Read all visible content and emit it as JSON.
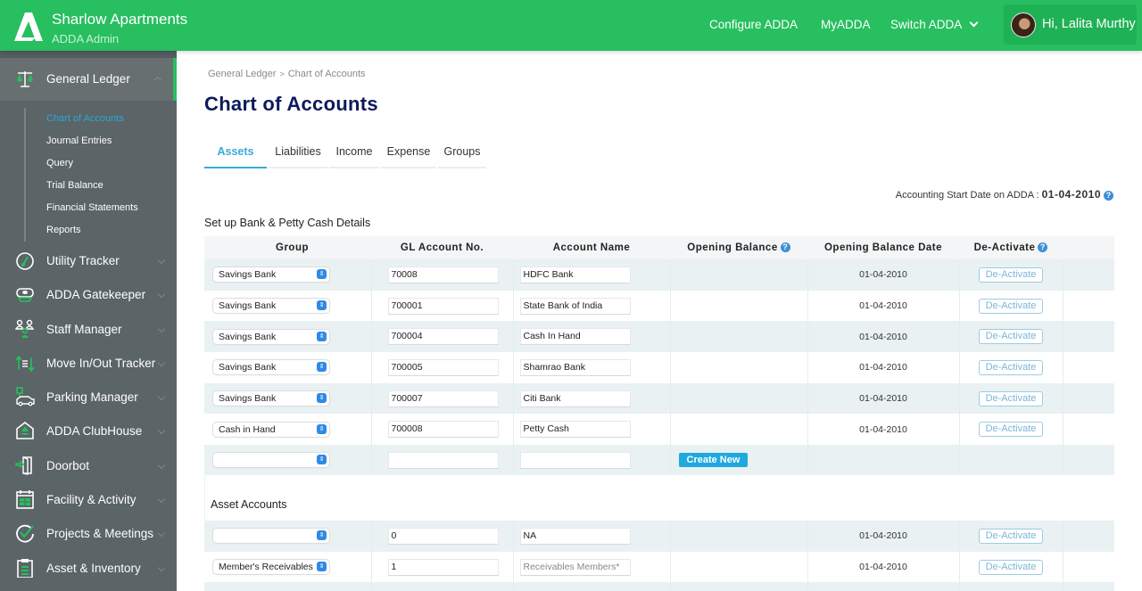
{
  "header": {
    "org_name": "Sharlow Apartments",
    "role": "ADDA Admin",
    "nav": [
      "Configure ADDA",
      "MyADDA",
      "Switch ADDA"
    ],
    "user_greeting": "Hi, Lalita Murthy",
    "brand_color": "#27bf5f"
  },
  "sidebar": {
    "active_section": "General Ledger",
    "submenu": [
      {
        "label": "Chart of Accounts",
        "active": true
      },
      {
        "label": "Journal Entries"
      },
      {
        "label": "Query"
      },
      {
        "label": "Trial Balance"
      },
      {
        "label": "Financial Statements"
      },
      {
        "label": "Reports"
      }
    ],
    "items": [
      {
        "label": "Utility Tracker",
        "icon": "gauge-icon"
      },
      {
        "label": "ADDA Gatekeeper",
        "icon": "guard-cap-icon"
      },
      {
        "label": "Staff Manager",
        "icon": "staff-icon"
      },
      {
        "label": "Move In/Out Tracker",
        "icon": "move-arrows-icon"
      },
      {
        "label": "Parking Manager",
        "icon": "parking-car-icon"
      },
      {
        "label": "ADDA ClubHouse",
        "icon": "clubhouse-icon"
      },
      {
        "label": "Doorbot",
        "icon": "door-icon"
      },
      {
        "label": "Facility & Activity",
        "icon": "calendar-icon"
      },
      {
        "label": "Projects & Meetings",
        "icon": "check-circle-icon"
      },
      {
        "label": "Asset & Inventory",
        "icon": "clipboard-icon"
      }
    ]
  },
  "main": {
    "breadcrumb": [
      "General Ledger",
      "Chart of Accounts"
    ],
    "title": "Chart of Accounts",
    "tabs": [
      {
        "label": "Assets",
        "active": true
      },
      {
        "label": "Liabilities"
      },
      {
        "label": "Income"
      },
      {
        "label": "Expense"
      },
      {
        "label": "Groups"
      }
    ],
    "accounting_start_label": "Accounting Start Date on ADDA : ",
    "accounting_start_date": "01-04-2010",
    "bank_section_title": "Set up Bank & Petty Cash Details",
    "columns": [
      "Group",
      "GL Account No.",
      "Account Name",
      "Opening Balance",
      "Opening Balance Date",
      "De-Activate"
    ],
    "bank_rows": [
      {
        "group": "Savings Bank",
        "gl": "70008",
        "name": "HDFC Bank",
        "date": "01-04-2010",
        "action": "De-Activate"
      },
      {
        "group": "Savings Bank",
        "gl": "700001",
        "name": "State Bank of India",
        "date": "01-04-2010",
        "action": "De-Activate"
      },
      {
        "group": "Savings Bank",
        "gl": "700004",
        "name": "Cash In Hand",
        "date": "01-04-2010",
        "action": "De-Activate"
      },
      {
        "group": "Savings Bank",
        "gl": "700005",
        "name": "Shamrao Bank",
        "date": "01-04-2010",
        "action": "De-Activate"
      },
      {
        "group": "Savings Bank",
        "gl": "700007",
        "name": "Citi Bank",
        "date": "01-04-2010",
        "action": "De-Activate"
      },
      {
        "group": "Cash in Hand",
        "gl": "700008",
        "name": "Petty Cash",
        "date": "01-04-2010",
        "action": "De-Activate"
      }
    ],
    "new_row": {
      "group": "",
      "gl": "",
      "name": "",
      "button": "Create New"
    },
    "asset_section_title": "Asset Accounts",
    "asset_rows": [
      {
        "group": "",
        "gl": "0",
        "name": "NA",
        "date": "01-04-2010",
        "action": "De-Activate"
      },
      {
        "group": "Member's Receivables",
        "gl": "1",
        "name_placeholder": "Receivables Members*",
        "date": "01-04-2010",
        "action": "De-Activate"
      }
    ]
  }
}
